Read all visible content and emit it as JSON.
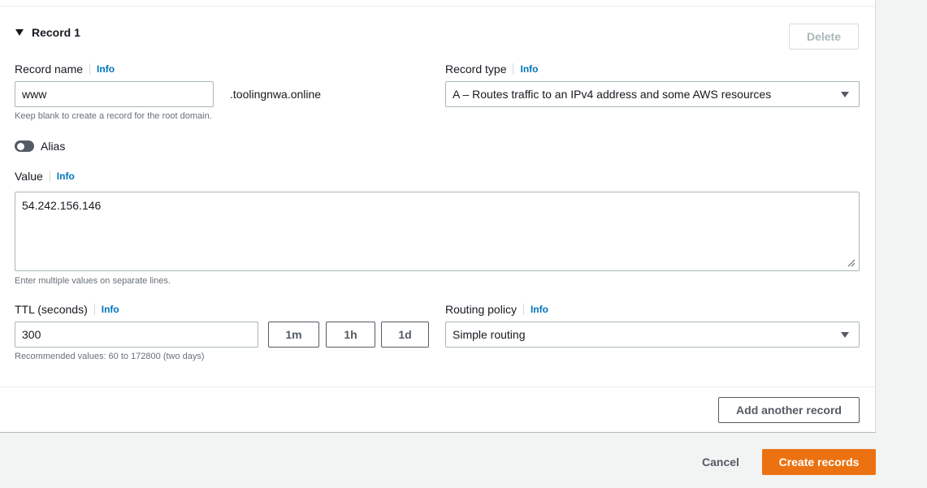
{
  "record": {
    "header": "Record 1",
    "delete_label": "Delete",
    "name_label": "Record name",
    "info_label": "Info",
    "name_value": "www",
    "domain_suffix": ".toolingnwa.online",
    "name_hint": "Keep blank to create a record for the root domain.",
    "type_label": "Record type",
    "type_value": "A – Routes traffic to an IPv4 address and some AWS resources",
    "alias_label": "Alias",
    "alias_on": false,
    "value_label": "Value",
    "value_text": "54.242.156.146",
    "value_hint": "Enter multiple values on separate lines.",
    "ttl_label": "TTL (seconds)",
    "ttl_value": "300",
    "ttl_presets": [
      "1m",
      "1h",
      "1d"
    ],
    "ttl_hint": "Recommended values: 60 to 172800 (two days)",
    "routing_label": "Routing policy",
    "routing_value": "Simple routing",
    "add_another_label": "Add another record"
  },
  "footer": {
    "cancel_label": "Cancel",
    "create_label": "Create records"
  },
  "colors": {
    "primary": "#ec7211",
    "link": "#0073bb"
  }
}
